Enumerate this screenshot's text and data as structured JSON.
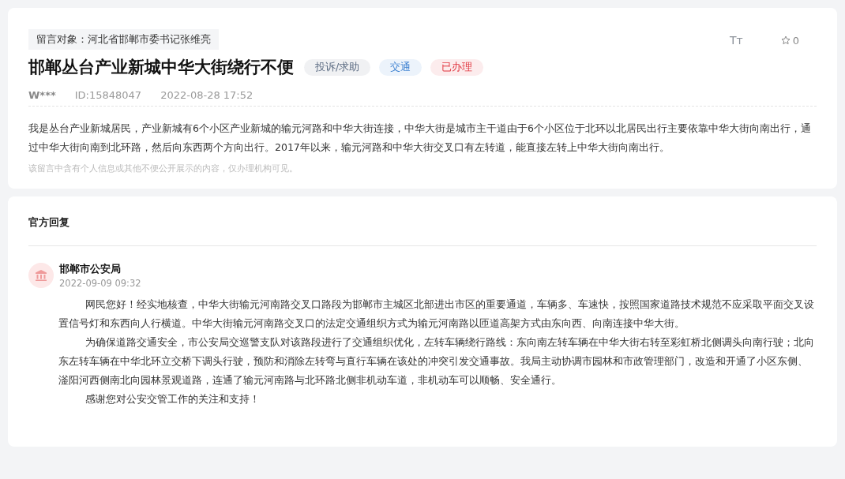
{
  "message": {
    "target": "留言对象：河北省邯郸市委书记张维亮",
    "title": "邯郸丛台产业新城中华大街绕行不便",
    "tags": [
      {
        "label": "投诉/求助",
        "color": "#5b6b82"
      },
      {
        "label": "交通",
        "color": "#3a7fd0"
      },
      {
        "label": "已办理",
        "color": "#e0353f"
      }
    ],
    "font_size_label": "Tт",
    "favorites": "0",
    "author": "W***",
    "id": "ID:15848047",
    "time": "2022-08-28 17:52",
    "body": "我是丛台产业新城居民，产业新城有6个小区产业新城的输元河路和中华大街连接，中华大街是城市主干道由于6个小区位于北环以北居民出行主要依靠中华大街向南出行，通过中华大街向南到北环路，然后向东西两个方向出行。2017年以来，输元河路和中华大街交叉口有左转道，能直接左转上中华大街向南出行。",
    "notice": "该留言中含有个人信息或其他不便公开展示的内容，仅办理机构可见。"
  },
  "reply": {
    "heading": "官方回复",
    "org": "邯郸市公安局",
    "time": "2022-09-09 09:32",
    "paragraphs": [
      "网民您好！经实地核查，中华大街输元河南路交叉口路段为邯郸市主城区北部进出市区的重要通道，车辆多、车速快，按照国家道路技术规范不应采取平面交叉设置信号灯和东西向人行横道。中华大街输元河南路交叉口的法定交通组织方式为输元河南路以匝道高架方式由东向西、向南连接中华大街。",
      "为确保道路交通安全，市公安局交巡警支队对该路段进行了交通组织优化，左转车辆绕行路线：东向南左转车辆在中华大街右转至彩虹桥北侧调头向南行驶；北向东左转车辆在中华北环立交桥下调头行驶，预防和消除左转弯与直行车辆在该处的冲突引发交通事故。我局主动协调市园林和市政管理部门，改造和开通了小区东侧、滏阳河西侧南北向园林景观道路，连通了输元河南路与北环路北侧非机动车道，非机动车可以顺畅、安全通行。",
      "感谢您对公安交管工作的关注和支持！"
    ]
  }
}
